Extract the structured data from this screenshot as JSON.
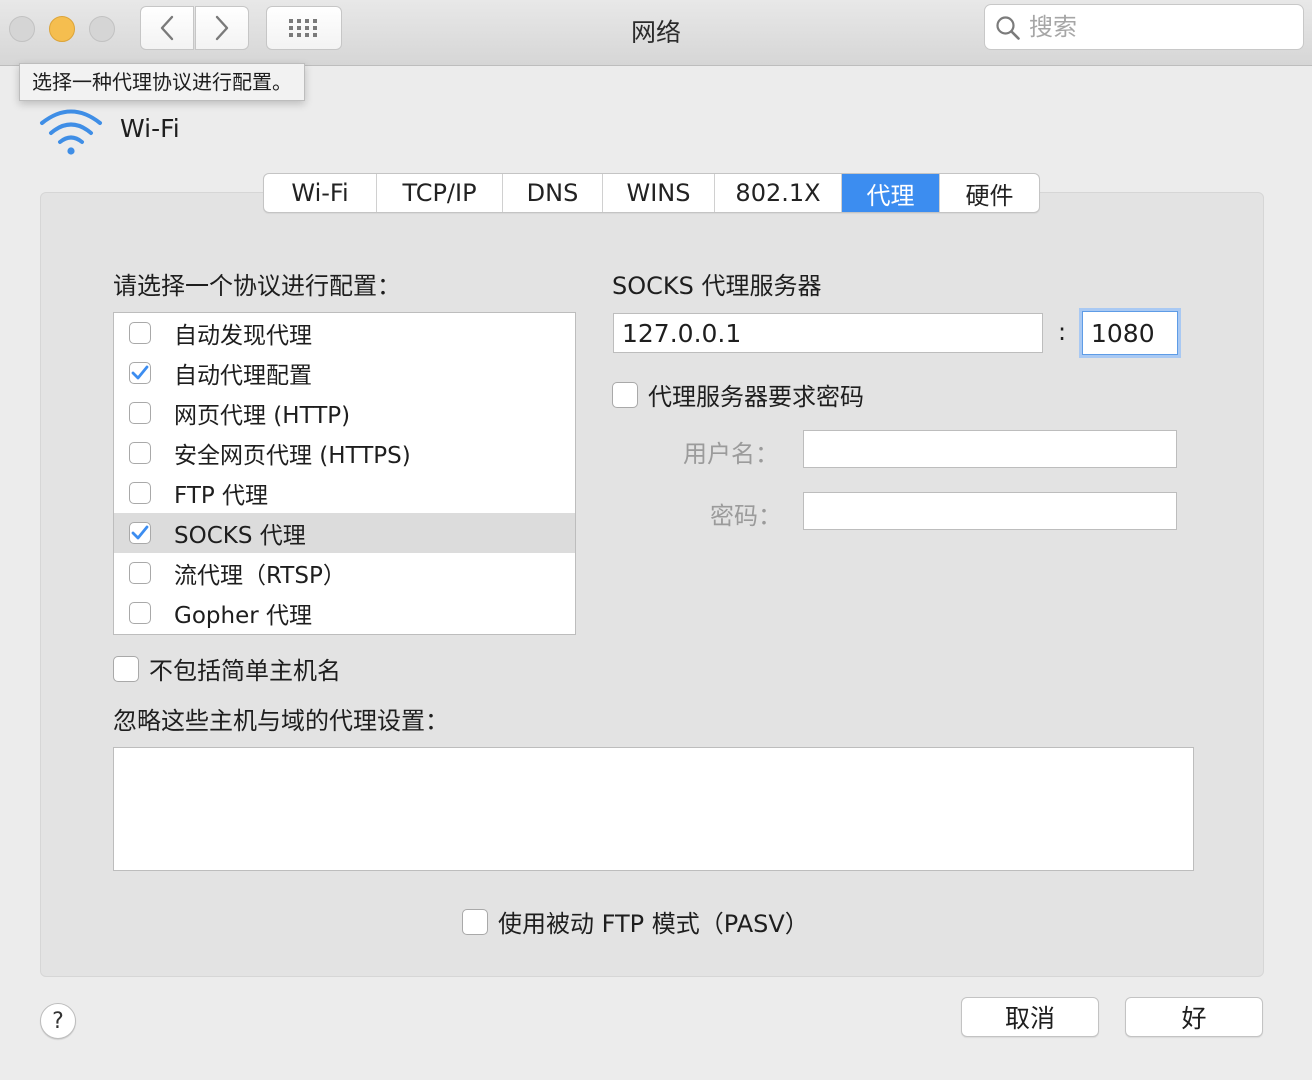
{
  "window": {
    "title": "网络"
  },
  "toolbar": {
    "search_placeholder": "搜索"
  },
  "tooltip": {
    "text": "选择一种代理协议进行配置。"
  },
  "header": {
    "interface_name": "Wi-Fi"
  },
  "tabs": [
    {
      "label": "Wi-Fi",
      "active": false
    },
    {
      "label": "TCP/IP",
      "active": false
    },
    {
      "label": "DNS",
      "active": false
    },
    {
      "label": "WINS",
      "active": false
    },
    {
      "label": "802.1X",
      "active": false
    },
    {
      "label": "代理",
      "active": true
    },
    {
      "label": "硬件",
      "active": false
    }
  ],
  "protocols": {
    "heading": "请选择一个协议进行配置：",
    "items": [
      {
        "label": "自动发现代理",
        "checked": false,
        "selected": false
      },
      {
        "label": "自动代理配置",
        "checked": true,
        "selected": false
      },
      {
        "label": "网页代理 (HTTP)",
        "checked": false,
        "selected": false
      },
      {
        "label": "安全网页代理 (HTTPS)",
        "checked": false,
        "selected": false
      },
      {
        "label": "FTP 代理",
        "checked": false,
        "selected": false
      },
      {
        "label": "SOCKS 代理",
        "checked": true,
        "selected": true
      },
      {
        "label": "流代理（RTSP）",
        "checked": false,
        "selected": false
      },
      {
        "label": "Gopher 代理",
        "checked": false,
        "selected": false
      }
    ]
  },
  "proxy_server": {
    "heading": "SOCKS 代理服务器",
    "host": "127.0.0.1",
    "separator": ":",
    "port": "1080",
    "requires_password_label": "代理服务器要求密码",
    "requires_password": false,
    "username_label": "用户名：",
    "username": "",
    "password_label": "密码：",
    "password": ""
  },
  "options": {
    "exclude_simple_hostnames_label": "不包括简单主机名",
    "exclude_simple_hostnames": false,
    "bypass_label": "忽略这些主机与域的代理设置：",
    "bypass_value": "",
    "passive_ftp_label": "使用被动 FTP 模式（PASV）",
    "passive_ftp": false
  },
  "buttons": {
    "cancel": "取消",
    "ok": "好",
    "help": "?"
  },
  "colors": {
    "accent": "#3c8df0",
    "min_button": "#f5be4f"
  },
  "icons": {
    "back": "chevron-left-icon",
    "forward": "chevron-right-icon",
    "grid": "grid-icon",
    "search": "search-icon",
    "wifi": "wifi-icon",
    "check": "checkmark-icon"
  }
}
